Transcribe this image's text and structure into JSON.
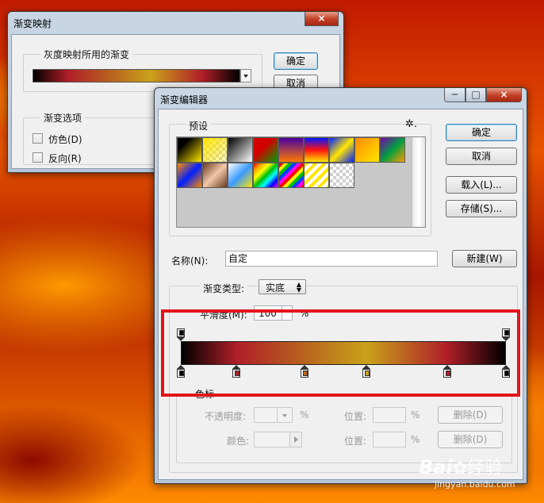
{
  "gradient_map_window": {
    "title": "渐变映射",
    "close_symbol": "×",
    "grayscale_group_label": "灰度映射所用的渐变",
    "ok_button": "确定",
    "cancel_button": "取消",
    "options_group_label": "渐变选项",
    "dither_label": "仿色(D)",
    "reverse_label": "反向(R)",
    "dither_checked": false,
    "reverse_checked": false
  },
  "gradient_editor_window": {
    "title": "渐变编辑器",
    "minimize_symbol": "─",
    "maximize_symbol": "□",
    "close_symbol": "×",
    "presets_label": "预设",
    "gear_symbol": "✲.",
    "ok_button": "确定",
    "cancel_button": "取消",
    "load_button": "载入(L)...",
    "save_button": "存储(S)...",
    "name_label": "名称(N):",
    "name_value": "自定",
    "new_button": "新建(W)",
    "gradient_type_label": "渐变类型:",
    "gradient_type_value": "实底",
    "smoothness_label": "平滑度(M):",
    "smoothness_value": "100",
    "smoothness_unit": "%",
    "color_stops_group_label": "色标",
    "opacity_label": "不透明度:",
    "opacity_unit": "%",
    "opacity_position_label": "位置:",
    "opacity_position_unit": "%",
    "opacity_delete_button": "删除(D)",
    "color_label": "颜色:",
    "color_position_label": "位置:",
    "color_position_unit": "%",
    "color_delete_button": "删除(D)",
    "color_stops": [
      {
        "color": "#000000",
        "location": 0
      },
      {
        "color": "#b01e28",
        "location": 17
      },
      {
        "color": "#b8641e",
        "location": 38
      },
      {
        "color": "#c9a21a",
        "location": 57
      },
      {
        "color": "#b01e28",
        "location": 82
      },
      {
        "color": "#000000",
        "location": 100
      }
    ],
    "opacity_stops": [
      {
        "opacity": 100,
        "location": 0
      },
      {
        "opacity": 100,
        "location": 100
      }
    ]
  },
  "watermark": {
    "brand": "Bai",
    "brand2": "经验",
    "url": "jingyan.baidu.com"
  },
  "colors": {
    "highlight_box": "#e3141b"
  }
}
